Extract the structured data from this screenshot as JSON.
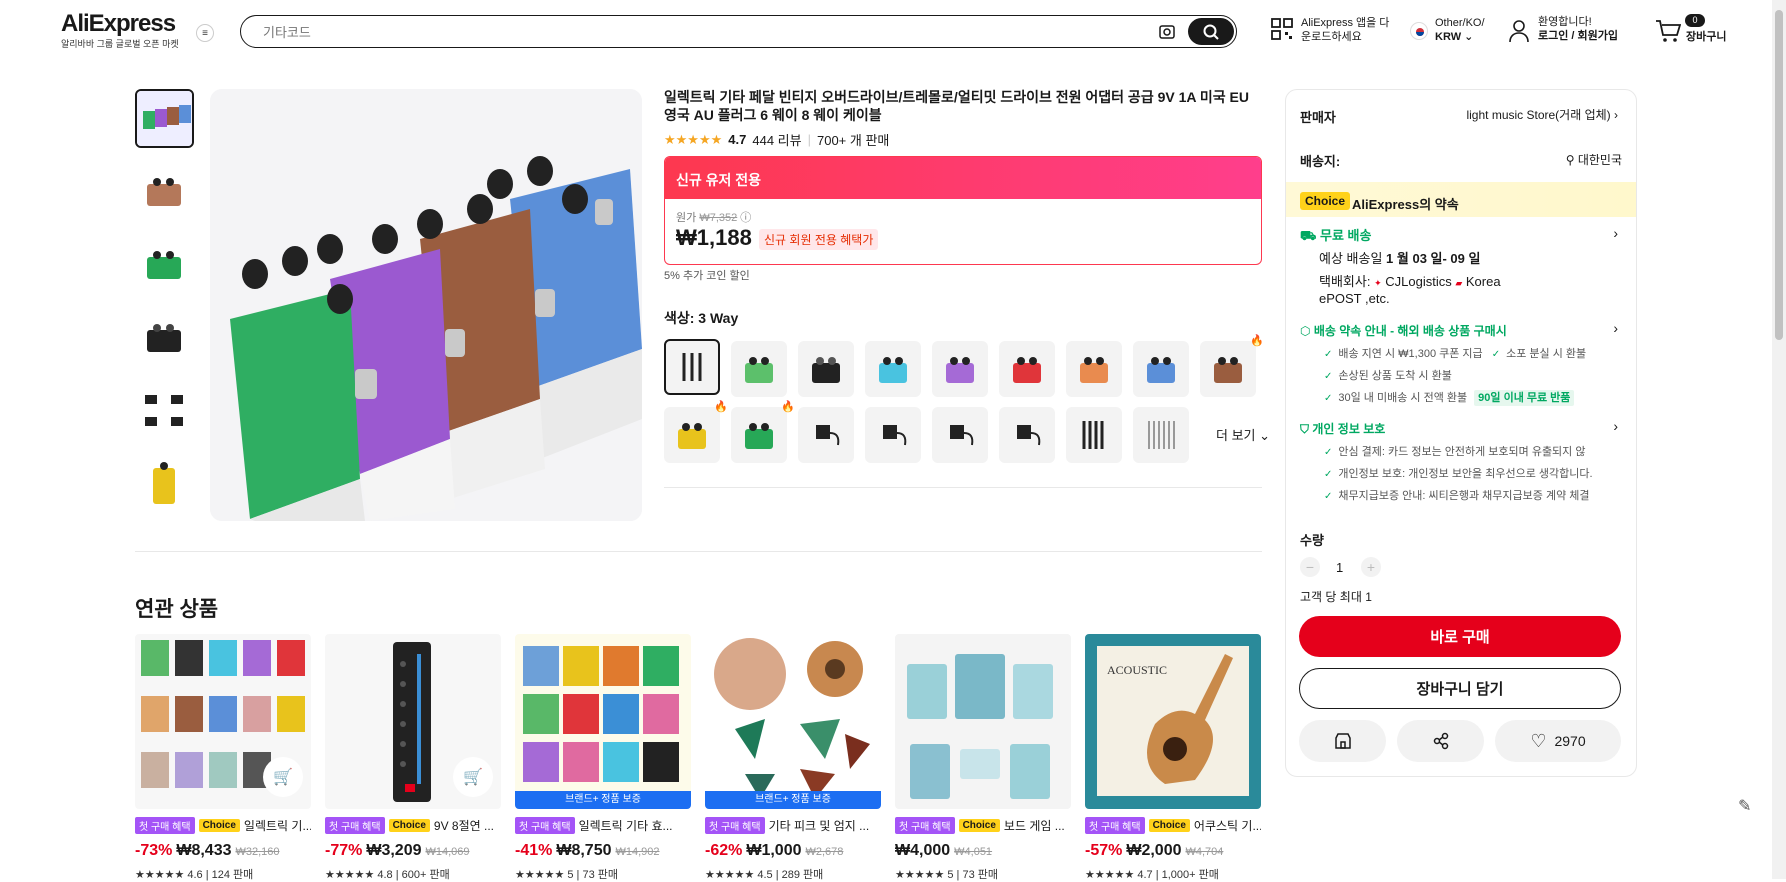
{
  "header": {
    "logo": "AliExpress",
    "logo_sub": "알리바바 그룹 글로벌 오픈 마켓",
    "search_placeholder": "기타코드",
    "app_line1": "AliExpress 앱을 다",
    "app_line2": "운로드하세요",
    "locale_line1": "Other/KO/",
    "locale_line2": "KRW",
    "user_line1": "환영합니다!",
    "user_line2": "로그인 / 회원가입",
    "cart_count": "0",
    "cart_label": "장바구니"
  },
  "product": {
    "title": "일렉트릭 기타 페달 빈티지 오버드라이브/트레몰로/얼티밋 드라이브 전원 어댑터 공급 9V 1A 미국 EU 영국 AU 플러그 6 웨이 8 웨이 케이블",
    "rating": "4.7",
    "reviews": "444 리뷰",
    "sold": "700+ 개 판매",
    "promo_header": "신규 유저 전용",
    "orig_label": "원가",
    "orig_price": "₩7,352",
    "price": "₩1,188",
    "new_badge": "신규 회원 전용 혜택가",
    "coin": "5% 추가 코인 할인",
    "color_label": "색상: 3 Way",
    "more": "더 보기"
  },
  "seller_panel": {
    "seller_label": "판매자",
    "seller_name": "light music Store(거래 업체)",
    "ship_label": "배송지:",
    "ship_to": "대한민국",
    "choice_tag": "Choice",
    "choice_promise": "AliExpress의 약속",
    "free_ship": "무료 배송",
    "eta_prefix": "예상 배송일",
    "eta": "1 월 03 일- 09 일",
    "courier_label": "택배회사:",
    "courier1": "CJLogistics",
    "courier2": "Korea",
    "courier3": "ePOST ,etc.",
    "guide_title": "배송 약속 안내 - 해외 배송 상품 구매시",
    "g1": "배송 지연 시 ₩1,300 쿠폰 지급",
    "g2": "소포 분실 시 환불",
    "g3": "손상된 상품 도착 시 환불",
    "g4": "30일 내 미배송 시 전액 환불",
    "g5": "90일 이내 무료 반품",
    "privacy_title": "개인 정보 보호",
    "p1": "안심 결제: 카드 정보는 안전하게 보호되며 유출되지 않",
    "p2": "개인정보 보호: 개인정보 보안을 최우선으로 생각합니다.",
    "p3": "채무지급보증 안내: 씨티은행과 채무지급보증 계약 체결",
    "qty_label": "수량",
    "qty": "1",
    "qty_limit": "고객 당 최대 1",
    "buy_now": "바로 구매",
    "add_cart": "장바구니 담기",
    "wish_count": "2970"
  },
  "related": {
    "title": "연관 상품",
    "items": [
      {
        "tag1": "첫 구매 혜택",
        "tag2": "Choice",
        "name": "일렉트릭 기...",
        "discount": "-73%",
        "price": "₩8,433",
        "orig": "₩32,160",
        "rating": "4.6 | 124 판매"
      },
      {
        "tag1": "첫 구매 혜택",
        "tag2": "Choice",
        "name": "9V 8절연 ...",
        "discount": "-77%",
        "price": "₩3,209",
        "orig": "₩14,069",
        "rating": "4.8 | 600+ 판매"
      },
      {
        "tag1": "첫 구매 혜택",
        "tag2": "",
        "name": "일렉트릭 기타 효...",
        "discount": "-41%",
        "price": "₩8,750",
        "orig": "₩14,902",
        "rating": "5 | 73 판매",
        "brand": "브랜드+ 정품 보증"
      },
      {
        "tag1": "첫 구매 혜택",
        "tag2": "",
        "name": "기타 피크 및 엄지 ...",
        "discount": "-62%",
        "price": "₩1,000",
        "orig": "₩2,678",
        "rating": "4.5 | 289 판매",
        "brand": "브랜드+ 정품 보증"
      },
      {
        "tag1": "첫 구매 혜택",
        "tag2": "Choice",
        "name": "보드 게임 ...",
        "discount": "",
        "price": "₩4,000",
        "orig": "₩4,051",
        "rating": "5 | 73 판매"
      },
      {
        "tag1": "첫 구매 혜택",
        "tag2": "Choice",
        "name": "어쿠스틱 기...",
        "discount": "-57%",
        "price": "₩2,000",
        "orig": "₩4,704",
        "rating": "4.7 | 1,000+ 판매"
      }
    ]
  },
  "colors": {
    "accent": "#e5001b",
    "green": "#00a861",
    "choice": "#ffd21a"
  }
}
